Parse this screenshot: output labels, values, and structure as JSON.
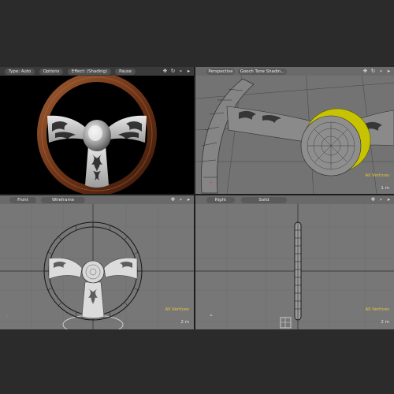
{
  "viewports": {
    "render": {
      "buttons": [
        "Type: Auto",
        "Options",
        "Effect: (Shading)",
        "Pause"
      ]
    },
    "perspective": {
      "buttons": [
        "Perspective",
        "Gooch Tone Shadin..."
      ],
      "selection_label": "All Vertices",
      "scale": "1 m"
    },
    "front": {
      "buttons": [
        "Front",
        "Wireframe"
      ],
      "selection_label": "All Vertices",
      "scale": "2 m"
    },
    "right": {
      "buttons": [
        "Right",
        "Solid"
      ],
      "selection_label": "All Vertices",
      "scale": "2 m"
    }
  },
  "toolbar_icons": [
    "move-icon",
    "rotate-icon",
    "zoom-icon",
    "arrow-icon"
  ],
  "colors": {
    "selection_text": "#e8c43c",
    "wood_rim": "#7a3f1e",
    "highlight_yellow": "#d8d200"
  }
}
